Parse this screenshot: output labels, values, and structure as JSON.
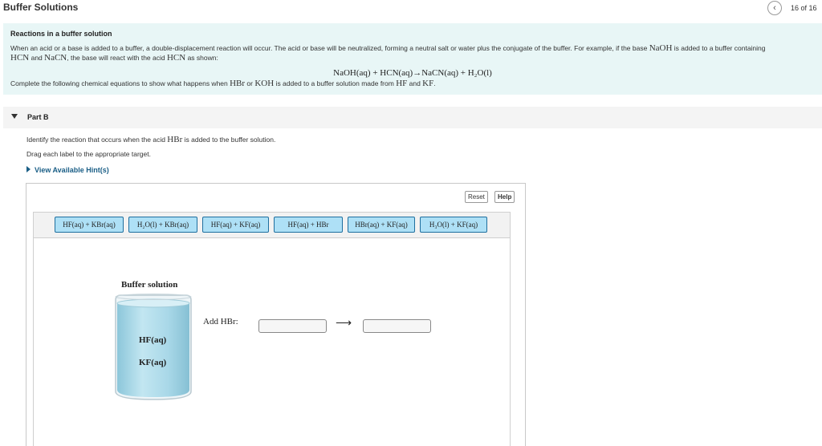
{
  "header": {
    "title": "Buffer Solutions",
    "back_icon": "chevron-left-icon",
    "back_glyph": "‹",
    "page_count": "16 of 16"
  },
  "intro": {
    "heading": "Reactions in a buffer solution",
    "p1_before_naoh": "When an acid or a base is added to a buffer, a double-displacement reaction will occur. The acid or base will be neutralized, forming a neutral salt or water plus the conjugate of the buffer. For example, if the base ",
    "p1_naoh": "NaOH",
    "p1_after_naoh": " is added to a buffer containing",
    "p1_hcn": "HCN",
    "p1_and": " and ",
    "p1_nacn": "NaCN",
    "p1_mid": ", the base will react with the acid ",
    "p1_hcn2": "HCN",
    "p1_end": " as shown:",
    "equation": "NaOH(aq) + HCN(aq)→NaCN(aq) + H₂O(l)",
    "p2_start": "Complete the following chemical equations to show what happens when ",
    "p2_hbr": "HBr",
    "p2_or": " or ",
    "p2_koh": "KOH",
    "p2_mid": " is added to a buffer solution made from ",
    "p2_hf": "HF",
    "p2_and": " and ",
    "p2_kf": "KF",
    "p2_end": "."
  },
  "part_b": {
    "label": "Part B",
    "instr_before": "Identify the reaction that occurs when the acid ",
    "instr_hbr": "HBr",
    "instr_after": " is added to the buffer solution.",
    "instr2": "Drag each label to the appropriate target.",
    "hint": "View Available Hint(s)"
  },
  "panel": {
    "reset": "Reset",
    "help": "Help",
    "labels": [
      "HF(aq) + KBr(aq)",
      "H₂O(l) + KBr(aq)",
      "HF(aq) + KF(aq)",
      "HF(aq) + HBr",
      "HBr(aq) + KF(aq)",
      "H₃O(l) + KF(aq)"
    ],
    "buffer_title": "Buffer solution",
    "beaker_lines": [
      "HF(aq)",
      "KF(aq)"
    ],
    "add_label": "Add HBr:",
    "arrow": "⟶"
  },
  "colors": {
    "intro_bg": "#e8f6f6",
    "chip_bg": "#aee0f6",
    "chip_border": "#1f6f9f",
    "hint": "#1a5e86",
    "beaker_liquid": "#a9d8e8"
  }
}
